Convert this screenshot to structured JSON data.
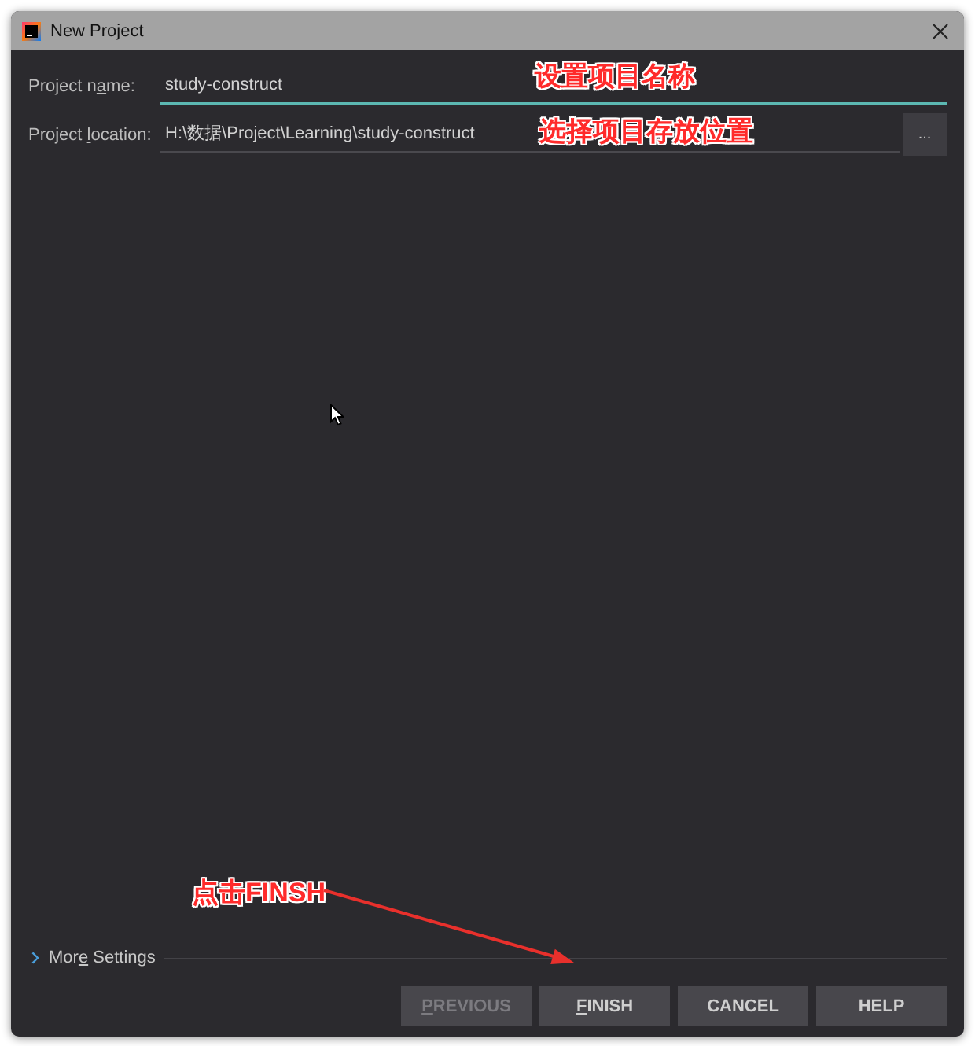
{
  "window": {
    "title": "New Project"
  },
  "fields": [
    {
      "label": [
        {
          "text": "Project n",
          "mnemonic": false
        },
        {
          "text": "a",
          "mnemonic": true
        },
        {
          "text": "me:",
          "mnemonic": false
        }
      ],
      "value": "study-construct",
      "focused": true
    },
    {
      "label": [
        {
          "text": "Project ",
          "mnemonic": false
        },
        {
          "text": "l",
          "mnemonic": true
        },
        {
          "text": "ocation:",
          "mnemonic": false
        }
      ],
      "value": "H:\\数据\\Project\\Learning\\study-construct",
      "focused": false,
      "browse_button": "..."
    }
  ],
  "more_settings": {
    "label": [
      {
        "text": "Mor",
        "mnemonic": false
      },
      {
        "text": "e",
        "mnemonic": true
      },
      {
        "text": " Settings",
        "mnemonic": false
      }
    ],
    "expanded": false
  },
  "buttons": [
    {
      "label": [
        {
          "text": "P",
          "mnemonic": true
        },
        {
          "text": "REVIOUS",
          "mnemonic": false
        }
      ],
      "disabled": true
    },
    {
      "label": [
        {
          "text": "F",
          "mnemonic": true
        },
        {
          "text": "INISH",
          "mnemonic": false
        }
      ],
      "disabled": false
    },
    {
      "label": [
        {
          "text": "CANCEL",
          "mnemonic": false
        }
      ],
      "disabled": false
    },
    {
      "label": [
        {
          "text": "HELP",
          "mnemonic": false
        }
      ],
      "disabled": false
    }
  ],
  "annotations": [
    {
      "text": "设置项目名称"
    },
    {
      "text": "选择项目存放位置"
    },
    {
      "text": "点击FINSH"
    }
  ]
}
